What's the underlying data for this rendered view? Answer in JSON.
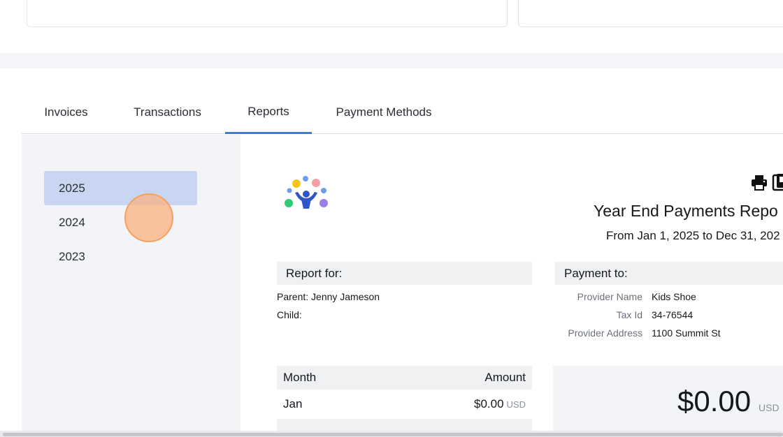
{
  "tabs": [
    {
      "label": "Invoices"
    },
    {
      "label": "Transactions"
    },
    {
      "label": "Reports",
      "active": true
    },
    {
      "label": "Payment Methods"
    }
  ],
  "years": [
    {
      "label": "2025",
      "selected": true
    },
    {
      "label": "2024"
    },
    {
      "label": "2023"
    }
  ],
  "report": {
    "title": "Year End Payments Repo",
    "range": "From Jan 1, 2025 to Dec 31, 202",
    "report_for": {
      "heading": "Report for:",
      "parent": "Parent: Jenny Jameson",
      "child": "Child:"
    },
    "payment_to": {
      "heading": "Payment to:",
      "provider_name_label": "Provider Name",
      "provider_name": "Kids Shoe",
      "tax_id_label": "Tax Id",
      "tax_id": "34-76544",
      "address_label": "Provider Address",
      "address": "1100 Summit St"
    },
    "table": {
      "month_header": "Month",
      "amount_header": "Amount",
      "rows": [
        {
          "month": "Jan",
          "amount": "$0.00",
          "currency": "USD"
        }
      ]
    },
    "total": {
      "amount": "$0.00",
      "currency": "USD"
    }
  },
  "icons": [
    "brand-logo-icon",
    "print-icon",
    "pdf-icon"
  ],
  "colors": {
    "accent": "#3a7ed6",
    "selected_year_bg": "#c8d6f2",
    "logo_blue": "#2f55c9",
    "logo_yellow": "#f5c518",
    "logo_pink": "#f2a0a6",
    "logo_green": "#2ecc71",
    "logo_purple": "#9b7ce8",
    "logo_lightblue": "#6e9cf0"
  }
}
